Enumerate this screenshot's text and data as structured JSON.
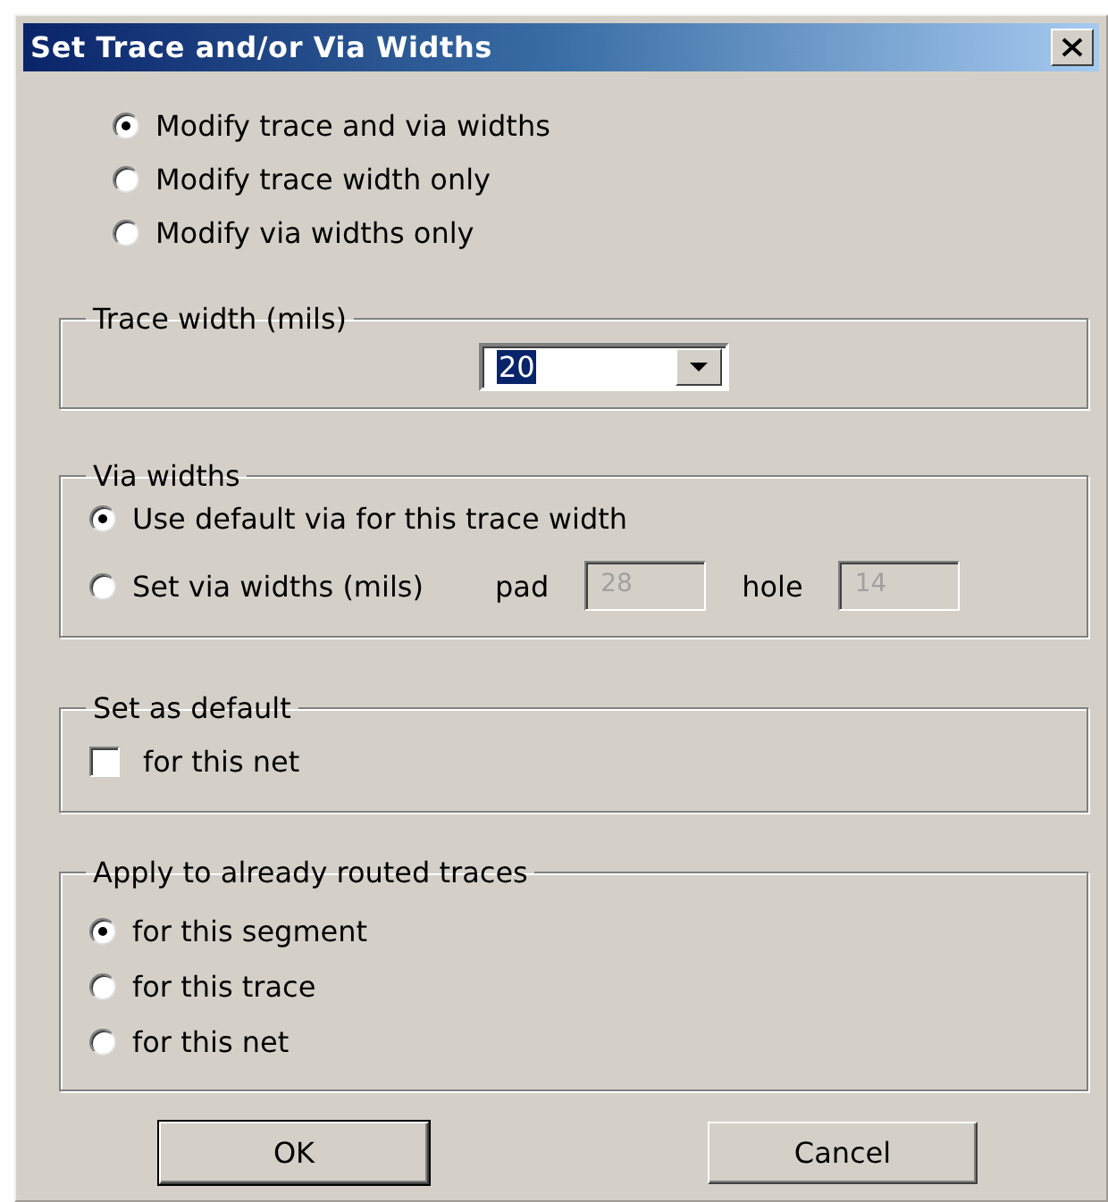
{
  "window": {
    "title": "Set Trace and/or Via Widths"
  },
  "mode_options": [
    {
      "label": "Modify trace and via widths",
      "selected": true
    },
    {
      "label": "Modify trace width only",
      "selected": false
    },
    {
      "label": "Modify via widths only",
      "selected": false
    }
  ],
  "trace_width": {
    "legend": "Trace width (mils)",
    "value": "20",
    "highlighted": true
  },
  "via_widths": {
    "legend": "Via widths",
    "options": [
      {
        "label": "Use default via for this trace width",
        "selected": true
      },
      {
        "label": "Set via widths (mils)",
        "selected": false
      }
    ],
    "fields": [
      {
        "label": "pad",
        "value": "28",
        "disabled": true
      },
      {
        "label": "hole",
        "value": "14",
        "disabled": true
      }
    ]
  },
  "set_as_default": {
    "legend": "Set as default",
    "label": "for this net",
    "checked": false
  },
  "apply_to": {
    "legend": "Apply to already routed traces",
    "options": [
      {
        "label": "for this segment",
        "selected": true
      },
      {
        "label": "for this trace",
        "selected": false
      },
      {
        "label": "for this net",
        "selected": false
      }
    ]
  },
  "buttons": [
    {
      "label": "OK",
      "default": true
    },
    {
      "label": "Cancel",
      "default": false
    }
  ]
}
